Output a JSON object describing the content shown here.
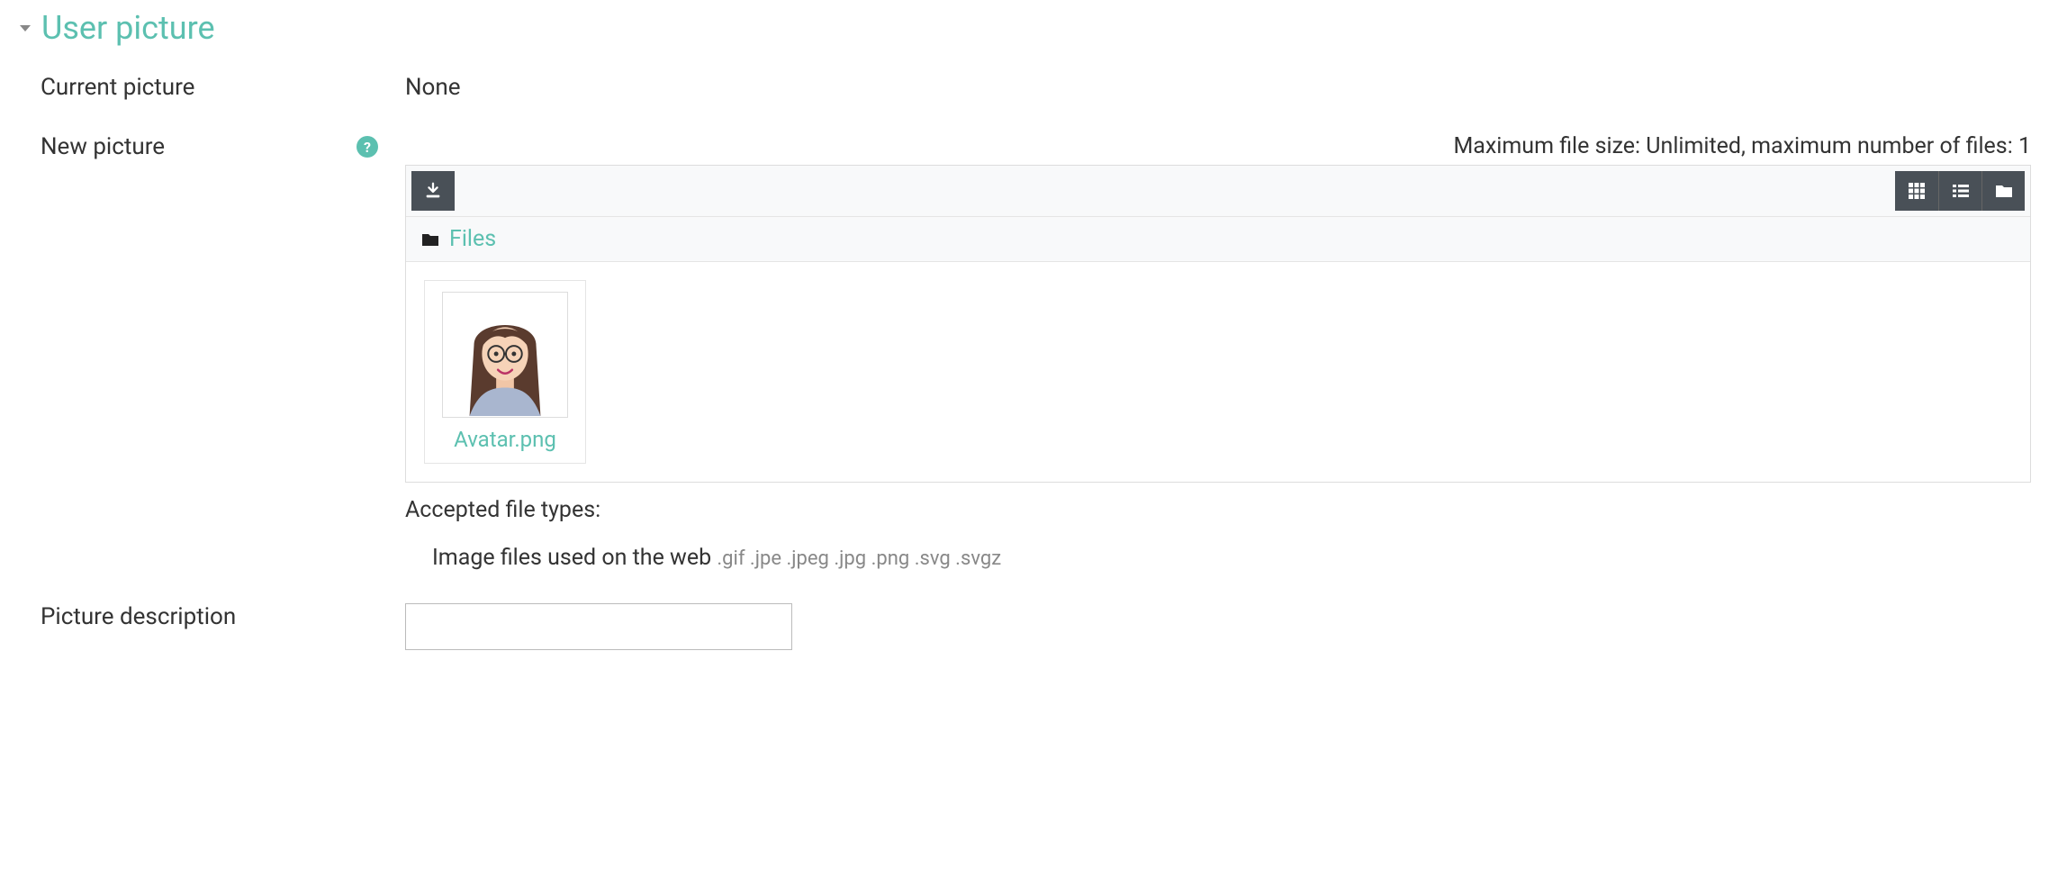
{
  "section": {
    "title": "User picture"
  },
  "fields": {
    "current_picture_label": "Current picture",
    "current_picture_value": "None",
    "new_picture_label": "New picture",
    "picture_description_label": "Picture description",
    "picture_description_value": ""
  },
  "file_picker": {
    "restrictions": "Maximum file size: Unlimited, maximum number of files: 1",
    "breadcrumb_root": "Files",
    "uploaded_file_name": "Avatar.png",
    "accepted_label": "Accepted file types:",
    "accepted_category": "Image files used on the web",
    "accepted_extensions": ".gif .jpe .jpeg .jpg .png .svg .svgz"
  },
  "icons": {
    "help": "?"
  }
}
